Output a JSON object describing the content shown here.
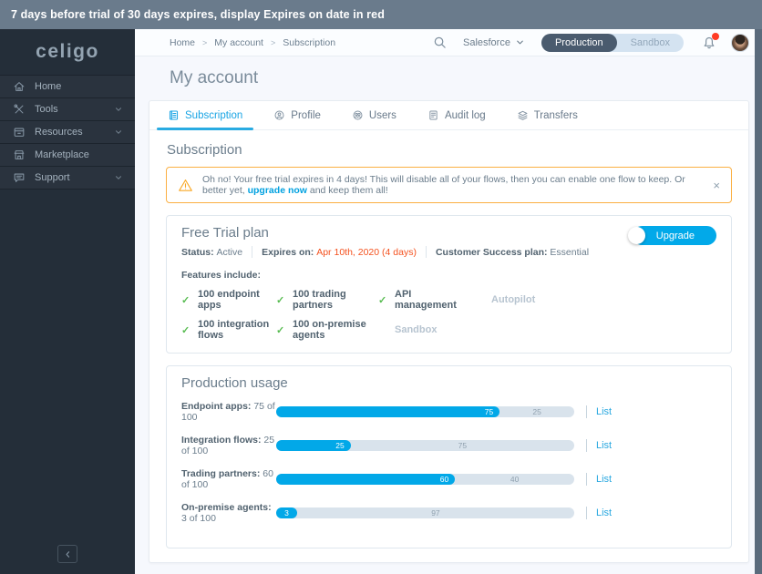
{
  "banner": {
    "text": "7 days before trial of 30 days expires, display Expires on date in red"
  },
  "icons": {
    "check": "✓",
    "dismiss": "×",
    "breadcrumb_separator": ">"
  },
  "colors": {
    "accent_blue": "#00a1e0",
    "error_red": "#f4511e",
    "warning_orange": "#f9a825",
    "success_green": "#58bc51"
  },
  "sidebar": {
    "logo": "celigo",
    "items": [
      {
        "label": "Home",
        "expandable": false
      },
      {
        "label": "Tools",
        "expandable": true
      },
      {
        "label": "Resources",
        "expandable": true
      },
      {
        "label": "Marketplace",
        "expandable": false
      },
      {
        "label": "Support",
        "expandable": true
      }
    ]
  },
  "header": {
    "breadcrumb": [
      "Home",
      "My account",
      "Subscription"
    ],
    "env_selector": "Salesforce",
    "environments": [
      "Production",
      "Sandbox"
    ],
    "selected_environment": "Production"
  },
  "page": {
    "title": "My account"
  },
  "tabs": [
    {
      "label": "Subscription"
    },
    {
      "label": "Profile"
    },
    {
      "label": "Users"
    },
    {
      "label": "Audit log"
    },
    {
      "label": "Transfers"
    }
  ],
  "subscription": {
    "section_title": "Subscription",
    "alert": {
      "text_before": "Oh no! Your free trial expires in 4 days! This will disable all of your flows, then you can enable one flow to keep. Or better yet, ",
      "link": "upgrade now",
      "text_after": " and keep them all!"
    },
    "plan": {
      "title": "Free Trial plan",
      "status_label": "Status:",
      "status_value": "Active",
      "expires_label": "Expires on:",
      "expires_value": "Apr 10th, 2020 (4 days)",
      "success_label": "Customer Success plan:",
      "success_value": "Essential",
      "upgrade_label": "Upgrade",
      "features_title": "Features include:",
      "features": [
        {
          "label": "100 endpoint apps",
          "included": true
        },
        {
          "label": "100 trading partners",
          "included": true
        },
        {
          "label": "API management",
          "included": true
        },
        {
          "label": "Autopilot",
          "included": false
        },
        {
          "label": "100 integration flows",
          "included": true
        },
        {
          "label": "100 on-premise agents",
          "included": true
        },
        {
          "label": "Sandbox",
          "included": false
        }
      ]
    },
    "usage": {
      "title": "Production usage",
      "list_label": "List",
      "rows": [
        {
          "label": "Endpoint apps:",
          "value": "75 of 100",
          "used": 75,
          "remaining": 25
        },
        {
          "label": "Integration flows:",
          "value": "25 of 100",
          "used": 25,
          "remaining": 75
        },
        {
          "label": "Trading partners:",
          "value": "60 of 100",
          "used": 60,
          "remaining": 40
        },
        {
          "label": "On-premise agents:",
          "value": "3 of 100",
          "used": 3,
          "remaining": 97
        }
      ]
    }
  }
}
